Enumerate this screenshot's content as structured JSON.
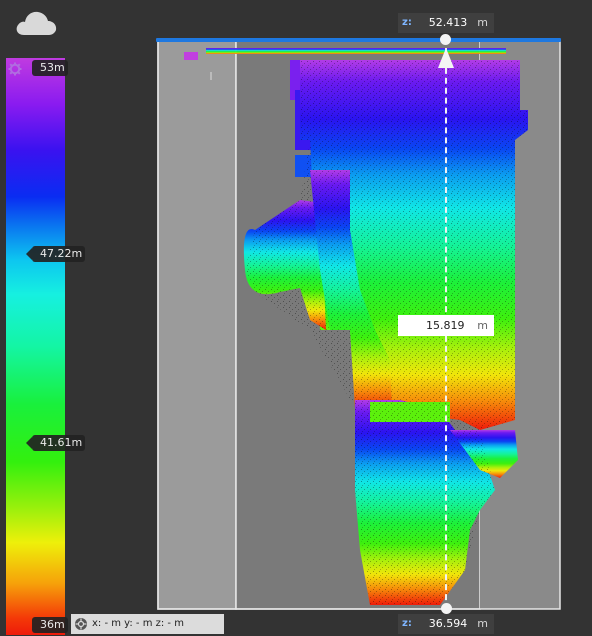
{
  "toolbar": {
    "cloud_icon": "cloud-icon"
  },
  "elevation_scale": {
    "settings_icon": "gear-icon",
    "max_label": "53m",
    "mid_high_label": "47.22m",
    "mid_low_label": "41.61m",
    "min_label": "36m"
  },
  "measurement": {
    "top": {
      "axis": "z:",
      "value": "52.413",
      "unit": "m"
    },
    "bottom": {
      "axis": "z:",
      "value": "36.594",
      "unit": "m"
    },
    "distance": {
      "value": "15.819",
      "unit": "m"
    }
  },
  "coordinates": {
    "text": "x: - m  y: - m  z: - m"
  },
  "colors": {
    "background": "#333333",
    "clip_bar": "#1e78e0",
    "readout_bg": "#3f3f3f",
    "axis_label": "#7fb6ff"
  }
}
